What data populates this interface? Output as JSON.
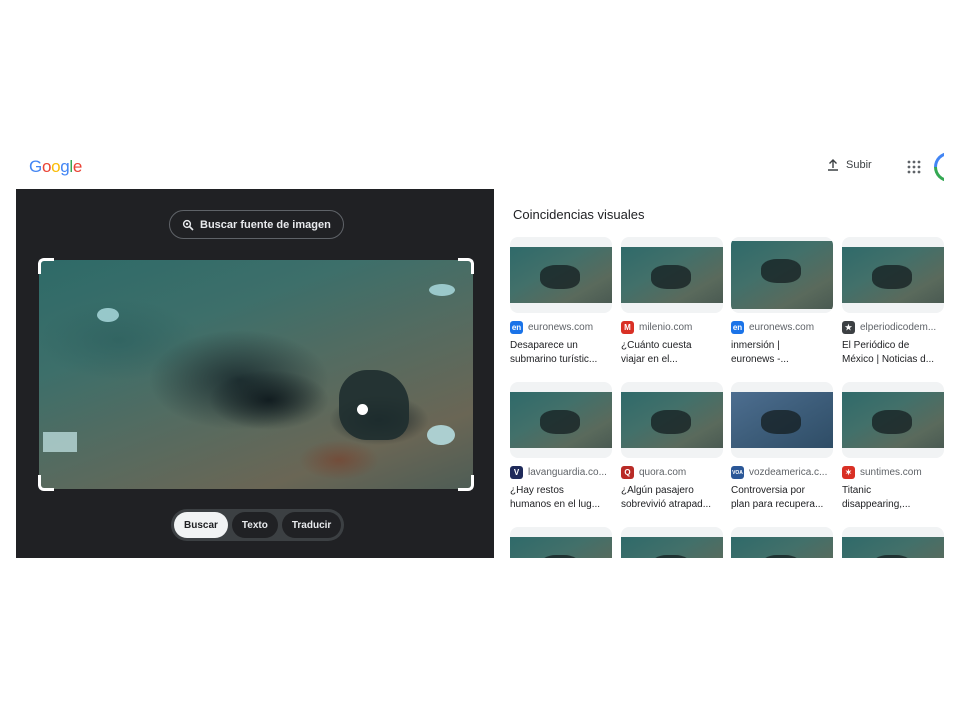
{
  "header": {
    "logo_letters": [
      {
        "ch": "G",
        "color": "#4285f4"
      },
      {
        "ch": "o",
        "color": "#ea4335"
      },
      {
        "ch": "o",
        "color": "#fbbc05"
      },
      {
        "ch": "g",
        "color": "#4285f4"
      },
      {
        "ch": "l",
        "color": "#34a853"
      },
      {
        "ch": "e",
        "color": "#ea4335"
      }
    ],
    "upload_label": "Subir",
    "upload_icon": "upload-icon",
    "apps_icon": "apps-grid-icon"
  },
  "left": {
    "source_button_label": "Buscar fuente de imagen",
    "source_button_icon": "lens-search-icon",
    "modes": [
      {
        "label": "Buscar",
        "active": true
      },
      {
        "label": "Texto",
        "active": false
      },
      {
        "label": "Traducir",
        "active": false
      }
    ]
  },
  "results": {
    "title": "Coincidencias visuales",
    "rows": [
      [
        {
          "source": "euronews.com",
          "fav_text": "en",
          "fav_color": "#1a73e8",
          "lines": [
            "Desaparece un",
            "submarino turístic..."
          ],
          "thumb": "green"
        },
        {
          "source": "milenio.com",
          "fav_text": "M",
          "fav_color": "#d93025",
          "lines": [
            "¿Cuánto cuesta",
            "viajar en el..."
          ],
          "thumb": "green"
        },
        {
          "source": "euronews.com",
          "fav_text": "en",
          "fav_color": "#1a73e8",
          "lines": [
            "inmersión |",
            "euronews -..."
          ],
          "thumb": "green-tall"
        },
        {
          "source": "elperiodicodem...",
          "fav_text": "★",
          "fav_color": "#3c4043",
          "lines": [
            "El Periódico de",
            "México | Noticias d..."
          ],
          "thumb": "green"
        }
      ],
      [
        {
          "source": "lavanguardia.co...",
          "fav_text": "V",
          "fav_color": "#1f2a5a",
          "lines": [
            "¿Hay restos",
            "humanos en el lug..."
          ],
          "thumb": "green"
        },
        {
          "source": "quora.com",
          "fav_text": "Q",
          "fav_color": "#b92b27",
          "lines": [
            "¿Algún pasajero",
            "sobrevivió atrapad..."
          ],
          "thumb": "green"
        },
        {
          "source": "vozdeamerica.c...",
          "fav_text": "VOA",
          "fav_color": "#2b5797",
          "lines": [
            "Controversia por",
            "plan para recupera..."
          ],
          "thumb": "blue"
        },
        {
          "source": "suntimes.com",
          "fav_text": "✶",
          "fav_color": "#d93025",
          "lines": [
            "Titanic",
            "disappearing,..."
          ],
          "thumb": "green"
        }
      ]
    ]
  }
}
